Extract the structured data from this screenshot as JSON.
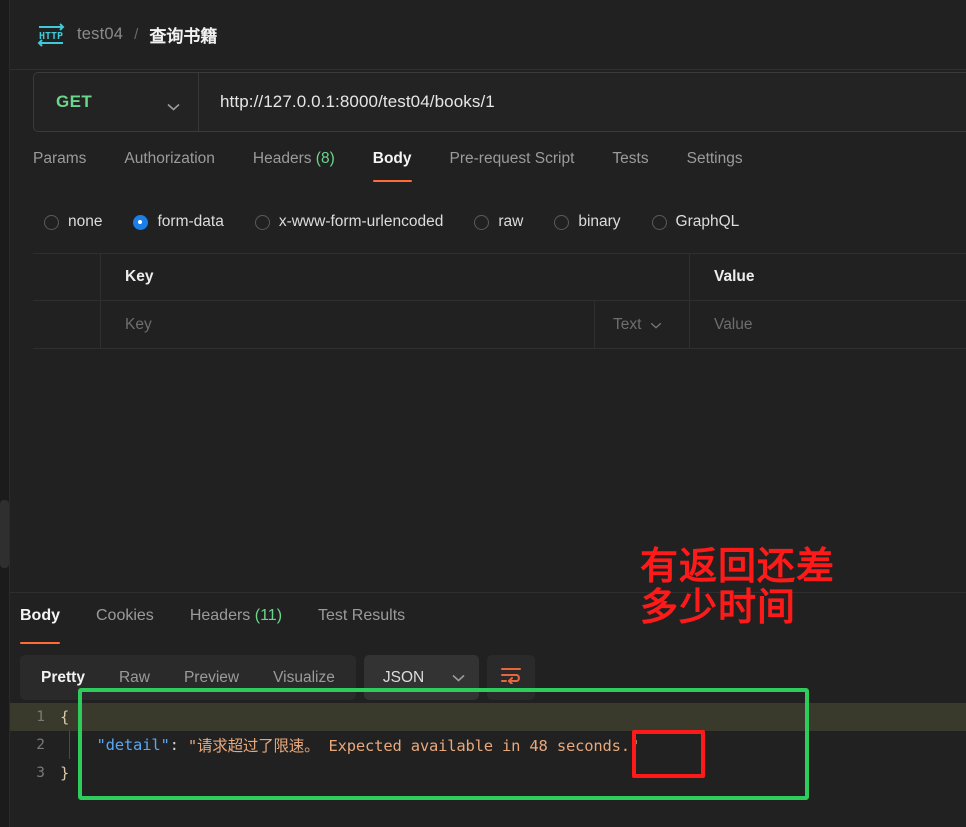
{
  "breadcrumb": {
    "icon": "http-protocol-icon",
    "parent": "test04",
    "separator": "/",
    "current": "查询书籍"
  },
  "request": {
    "method": "GET",
    "url": "http://127.0.0.1:8000/test04/books/1",
    "tabs": [
      {
        "label": "Params",
        "count": "",
        "active": false
      },
      {
        "label": "Authorization",
        "count": "",
        "active": false
      },
      {
        "label": "Headers",
        "count": "(8)",
        "active": false
      },
      {
        "label": "Body",
        "count": "",
        "active": true
      },
      {
        "label": "Pre-request Script",
        "count": "",
        "active": false
      },
      {
        "label": "Tests",
        "count": "",
        "active": false
      },
      {
        "label": "Settings",
        "count": "",
        "active": false
      }
    ],
    "body_types": [
      {
        "label": "none",
        "checked": false
      },
      {
        "label": "form-data",
        "checked": true
      },
      {
        "label": "x-www-form-urlencoded",
        "checked": false
      },
      {
        "label": "raw",
        "checked": false
      },
      {
        "label": "binary",
        "checked": false
      },
      {
        "label": "GraphQL",
        "checked": false
      }
    ],
    "table": {
      "headers": {
        "key": "Key",
        "value": "Value"
      },
      "row": {
        "key_placeholder": "Key",
        "type": "Text",
        "value_placeholder": "Value"
      }
    }
  },
  "response": {
    "tabs": [
      {
        "label": "Body",
        "count": "",
        "active": true
      },
      {
        "label": "Cookies",
        "count": "",
        "active": false
      },
      {
        "label": "Headers",
        "count": "(11)",
        "active": false
      },
      {
        "label": "Test Results",
        "count": "",
        "active": false
      }
    ],
    "view_modes": [
      {
        "label": "Pretty",
        "active": true
      },
      {
        "label": "Raw",
        "active": false
      },
      {
        "label": "Preview",
        "active": false
      },
      {
        "label": "Visualize",
        "active": false
      }
    ],
    "format": "JSON",
    "wrap_icon": "wrap-lines-icon",
    "code": {
      "line_numbers": [
        "1",
        "2",
        "3"
      ],
      "line1": "{",
      "line2_indent": "    ",
      "line2_key": "\"detail\"",
      "line2_colon": ": ",
      "line2_value": "\"请求超过了限速。 Expected available in 48 seconds.\"",
      "line3": "}"
    }
  },
  "annotations": {
    "red_note_line1": "有返回还差",
    "red_note_line2": "多少时间",
    "green_box_label": "response-body-highlight",
    "red_box_label": "seconds-value-highlight"
  },
  "colors": {
    "accent_orange": "#ff6c37",
    "method_green": "#6bd68a",
    "radio_blue": "#1c7fe8",
    "annotation_red": "#ff1a1a",
    "annotation_green": "#2ecc5a",
    "json_key_blue": "#56a8f5",
    "json_string_orange": "#e8a87c"
  }
}
